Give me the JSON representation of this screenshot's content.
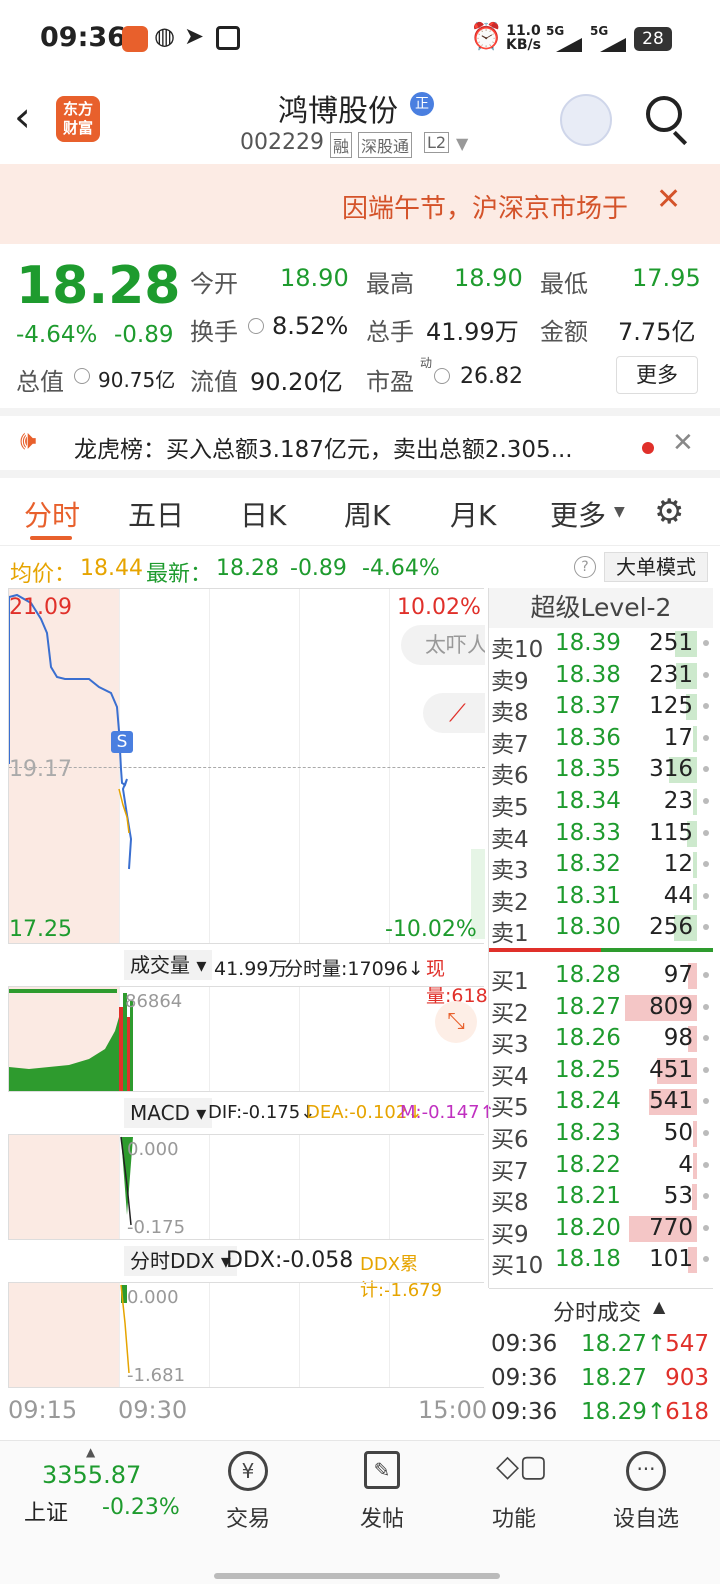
{
  "status": {
    "time": "09:36",
    "speed": "11.0",
    "speed_unit": "KB/s",
    "sig1": "5G",
    "sig2": "5G",
    "battery": "28"
  },
  "header": {
    "logo_line1": "东方",
    "logo_line2": "财富",
    "stock_name": "鸿博股份",
    "badge": "正",
    "code": "002229",
    "tag_margin": "融",
    "tag_connect": "深股通",
    "tag_level": "L2"
  },
  "banner": {
    "text": "因端午节，沪深京市场于"
  },
  "quote": {
    "price": "18.28",
    "pct": "-4.64%",
    "chg": "-0.89",
    "open_label": "今开",
    "open": "18.90",
    "high_label": "最高",
    "high": "18.90",
    "low_label": "最低",
    "low": "17.95",
    "turnover_label": "换手",
    "turnover": "8.52%",
    "volume_label": "总手",
    "volume": "41.99万",
    "amount_label": "金额",
    "amount": "7.75亿",
    "mcap_label": "总值",
    "mcap": "90.75亿",
    "float_label": "流值",
    "float": "90.20亿",
    "pe_label": "市盈",
    "pe_sup": "动",
    "pe": "26.82",
    "more": "更多"
  },
  "lhb": {
    "text": "龙虎榜：买入总额3.187亿元，卖出总额2.305..."
  },
  "tabs": [
    "分时",
    "五日",
    "日K",
    "周K",
    "月K",
    "更多"
  ],
  "infobar": {
    "avg_label": "均价：",
    "avg": "18.44",
    "last_label": "最新：",
    "last": "18.28",
    "chg": "-0.89",
    "pct": "-4.64%",
    "mode": "大单模式"
  },
  "chart": {
    "top_price": "21.09",
    "mid_price": "19.17",
    "bottom_price": "17.25",
    "top_pct": "10.02%",
    "bottom_pct": "-10.02%",
    "float_btn": "太吓人",
    "s_mark": "S"
  },
  "volume_panel": {
    "label": "成交量",
    "total": "41.99万",
    "tick": "分时量:17096↓",
    "now": "现量:618",
    "max": "86864"
  },
  "macd_panel": {
    "label": "MACD",
    "dif": "DIF:-0.175↓",
    "dea": "DEA:-0.102↓",
    "m": "M:-0.147↑",
    "top": "0.000",
    "bottom": "-0.175"
  },
  "ddx_panel": {
    "label": "分时DDX",
    "ddx": "DDX:-0.058",
    "ddx_sum": "DDX累计:-1.679",
    "top": "0.000",
    "bottom": "-1.681"
  },
  "time_axis": {
    "t1": "09:15",
    "t2": "09:30",
    "t3": "15:00"
  },
  "orderbook": {
    "title": "超级Level-2",
    "asks": [
      {
        "l": "卖10",
        "p": "18.39",
        "v": "251"
      },
      {
        "l": "卖9",
        "p": "18.38",
        "v": "231"
      },
      {
        "l": "卖8",
        "p": "18.37",
        "v": "125"
      },
      {
        "l": "卖7",
        "p": "18.36",
        "v": "17"
      },
      {
        "l": "卖6",
        "p": "18.35",
        "v": "316"
      },
      {
        "l": "卖5",
        "p": "18.34",
        "v": "23"
      },
      {
        "l": "卖4",
        "p": "18.33",
        "v": "115"
      },
      {
        "l": "卖3",
        "p": "18.32",
        "v": "12"
      },
      {
        "l": "卖2",
        "p": "18.31",
        "v": "44"
      },
      {
        "l": "卖1",
        "p": "18.30",
        "v": "256"
      }
    ],
    "bids": [
      {
        "l": "买1",
        "p": "18.28",
        "v": "97"
      },
      {
        "l": "买2",
        "p": "18.27",
        "v": "809"
      },
      {
        "l": "买3",
        "p": "18.26",
        "v": "98"
      },
      {
        "l": "买4",
        "p": "18.25",
        "v": "451"
      },
      {
        "l": "买5",
        "p": "18.24",
        "v": "541"
      },
      {
        "l": "买6",
        "p": "18.23",
        "v": "50"
      },
      {
        "l": "买7",
        "p": "18.22",
        "v": "4"
      },
      {
        "l": "买8",
        "p": "18.21",
        "v": "53"
      },
      {
        "l": "买9",
        "p": "18.20",
        "v": "770"
      },
      {
        "l": "买10",
        "p": "18.18",
        "v": "101"
      }
    ]
  },
  "trades": {
    "title": "分时成交",
    "rows": [
      {
        "t": "09:36",
        "p": "18.27↑",
        "v": "547"
      },
      {
        "t": "09:36",
        "p": "18.27",
        "v": "903"
      },
      {
        "t": "09:36",
        "p": "18.29↑",
        "v": "618"
      }
    ]
  },
  "bottom_nav": {
    "index_value": "3355.87",
    "index_name": "上证",
    "index_pct": "-0.23%",
    "items": [
      "交易",
      "发帖",
      "功能",
      "设自选"
    ]
  }
}
